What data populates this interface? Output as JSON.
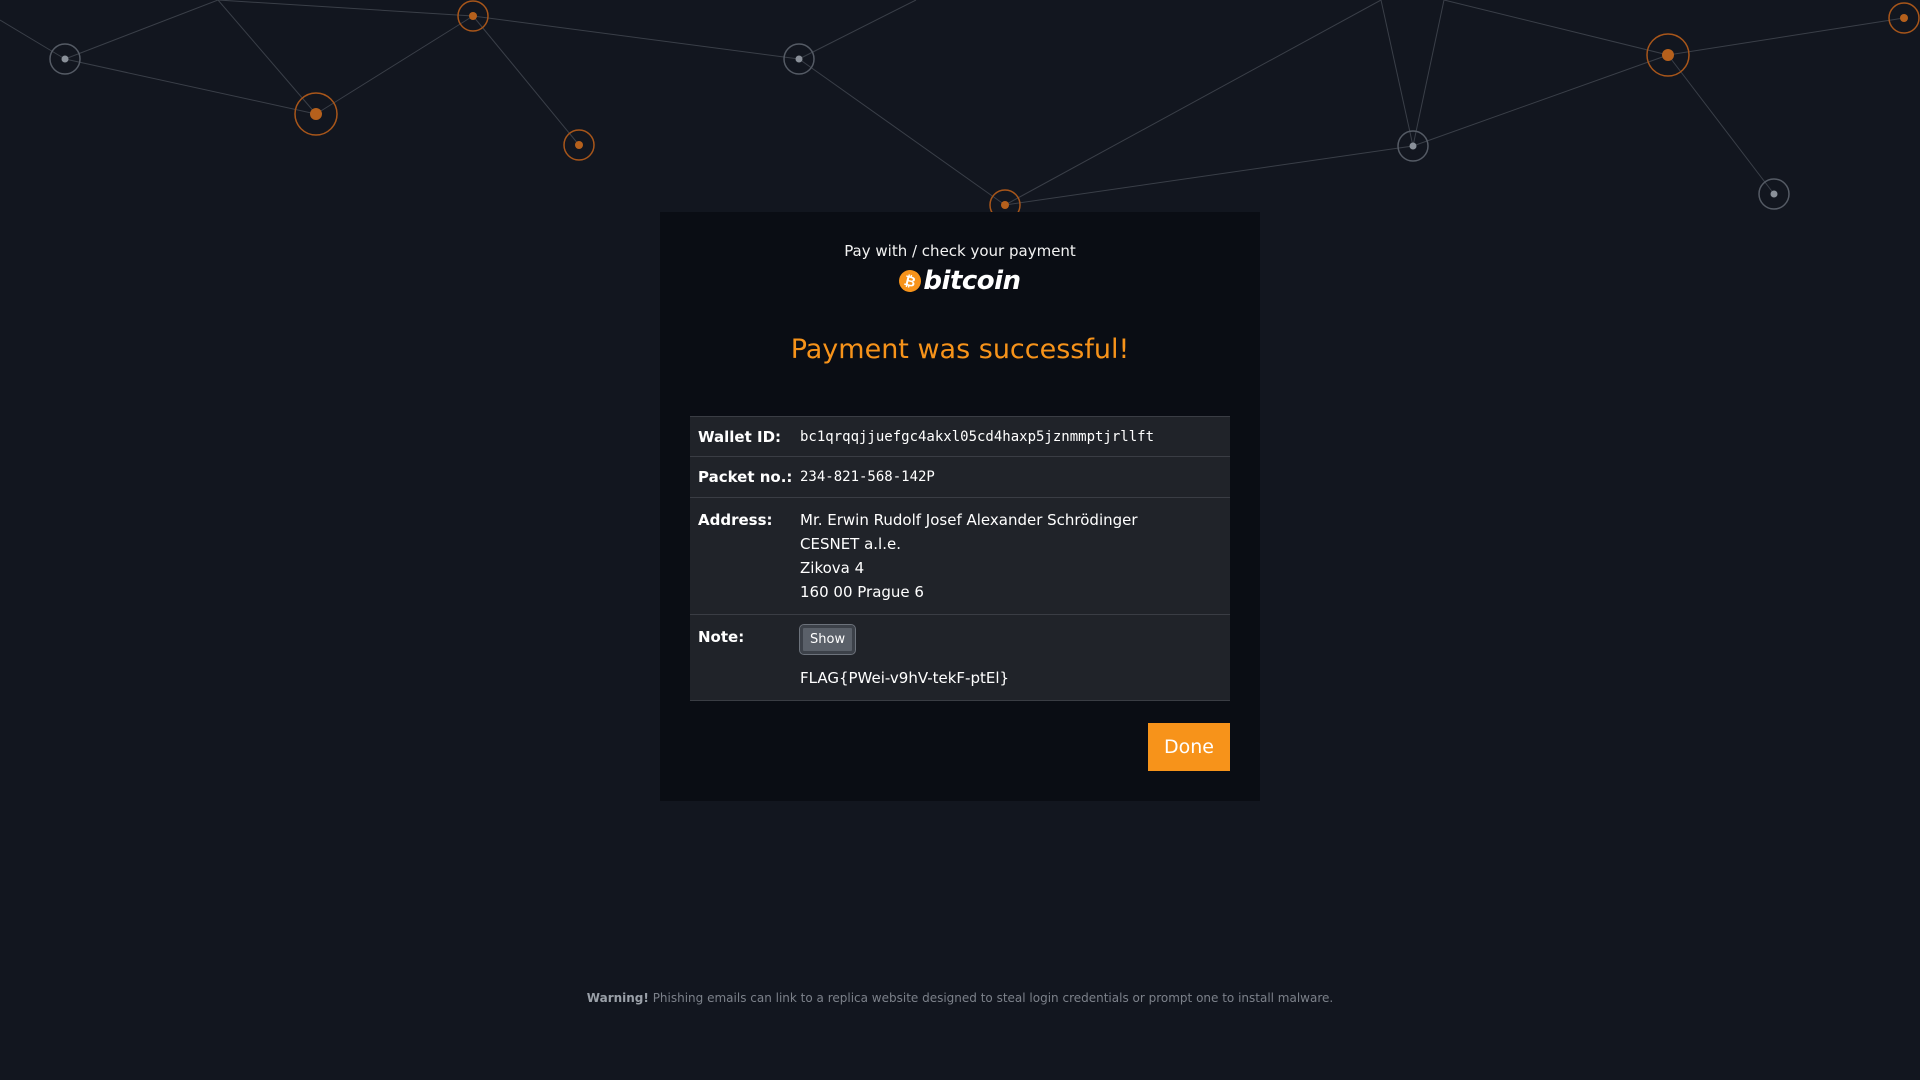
{
  "colors": {
    "background": "#12161f",
    "card": "#0a0d14",
    "accent": "#f7931a",
    "table": "#202329"
  },
  "header": {
    "intro": "Pay with / check your payment",
    "logo_text": "bitcoin",
    "logo_icon": "bitcoin-coin-icon",
    "logo_symbol": "₿"
  },
  "status": {
    "headline": "Payment was successful!"
  },
  "details": {
    "wallet_label": "Wallet ID:",
    "wallet_value": "bc1qrqqjjuefgc4akxl05cd4haxp5jznmmptjrllft",
    "packet_label": "Packet no.:",
    "packet_value": "234-821-568-142P",
    "address_label": "Address:",
    "address_lines": [
      "Mr. Erwin Rudolf Josef Alexander Schrödinger",
      "CESNET a.l.e.",
      "Zikova 4",
      "160 00 Prague 6"
    ],
    "note_label": "Note:",
    "note_button": "Show",
    "note_text": "FLAG{PWei-v9hV-tekF-ptEl}"
  },
  "actions": {
    "done_label": "Done"
  },
  "footer": {
    "warning_strong": "Warning!",
    "warning_text": " Phishing emails can link to a replica website designed to steal login credentials or prompt one to install malware."
  }
}
